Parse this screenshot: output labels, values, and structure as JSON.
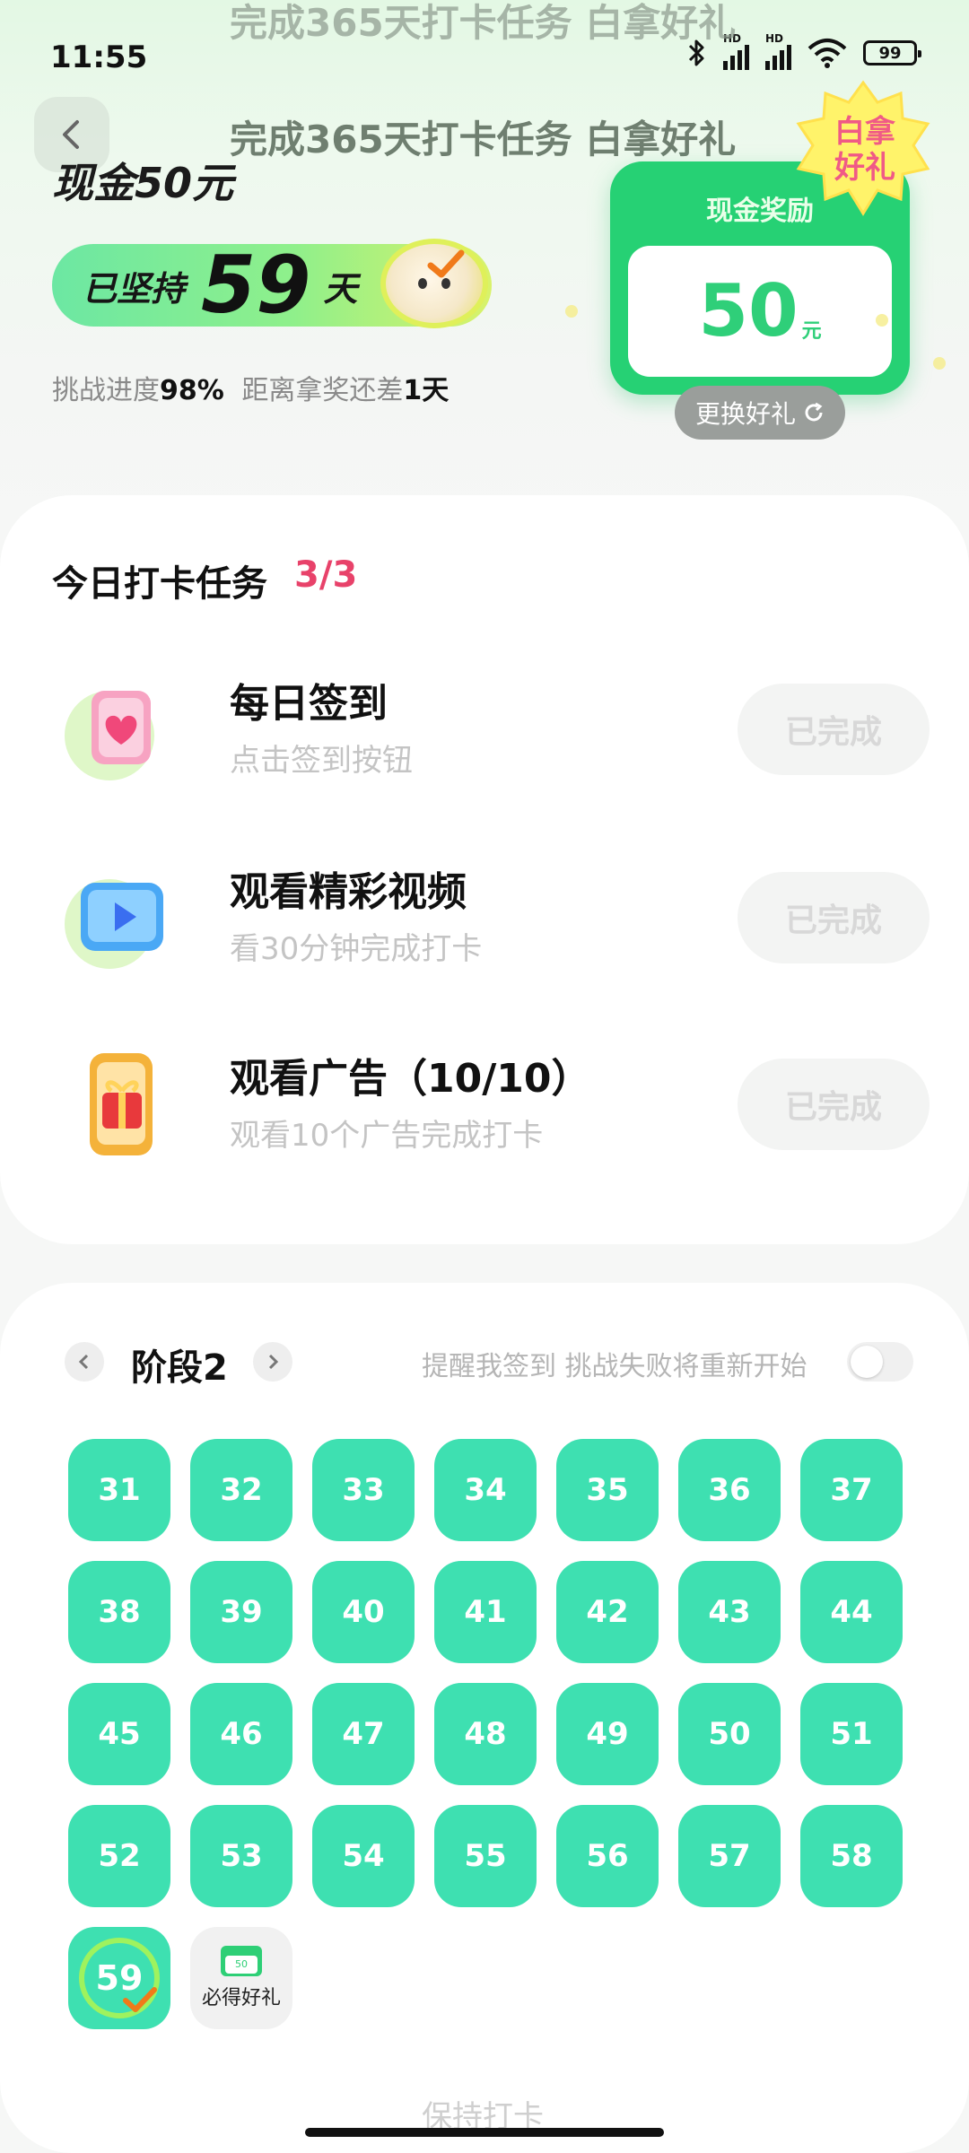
{
  "status_bar": {
    "time": "11:55",
    "battery": "99",
    "network_label": "HD"
  },
  "header": {
    "title": "完成365天打卡任务 白拿好礼",
    "ghost_title": "完成365天打卡任务 白拿好礼"
  },
  "hero": {
    "reward_name": "现金50元",
    "streak_prefix": "已坚持",
    "streak_days": "59",
    "streak_suffix": "天",
    "progress_label": "挑战进度",
    "progress_value": "98%",
    "remain_label": "距离拿奖还差",
    "remain_value": "1天",
    "progress_fraction": 0.98
  },
  "reward_card": {
    "title": "现金奖励",
    "amount": "50",
    "unit": "元",
    "badge_line1": "白拿",
    "badge_line2": "好礼",
    "swap_label": "更换好礼",
    "swap_icon": "refresh-icon"
  },
  "tasks": {
    "title": "今日打卡任务",
    "count": "3/3",
    "items": [
      {
        "name": "每日签到",
        "desc": "点击签到按钮",
        "button": "已完成",
        "icon": "heart-bag-icon"
      },
      {
        "name": "观看精彩视频",
        "desc": "看30分钟完成打卡",
        "button": "已完成",
        "icon": "video-play-icon"
      },
      {
        "name": "观看广告（10/10）",
        "desc": "观看10个广告完成打卡",
        "button": "已完成",
        "icon": "gift-phone-icon"
      }
    ]
  },
  "stage": {
    "label": "阶段2",
    "reminder_text": "提醒我签到 挑战失败将重新开始",
    "reminder_enabled": false,
    "days": [
      "31",
      "32",
      "33",
      "34",
      "35",
      "36",
      "37",
      "38",
      "39",
      "40",
      "41",
      "42",
      "43",
      "44",
      "45",
      "46",
      "47",
      "48",
      "49",
      "50",
      "51",
      "52",
      "53",
      "54",
      "55",
      "56",
      "57",
      "58"
    ],
    "current_day": "59",
    "gift_label": "必得好礼",
    "gift_mini": "50"
  },
  "footer": {
    "faded_text": "保持打卡"
  },
  "colors": {
    "accent_green": "#3ee0b1",
    "reward_green": "#26d174",
    "count_red": "#e8426a",
    "done_gray": "#d8d8d8"
  }
}
